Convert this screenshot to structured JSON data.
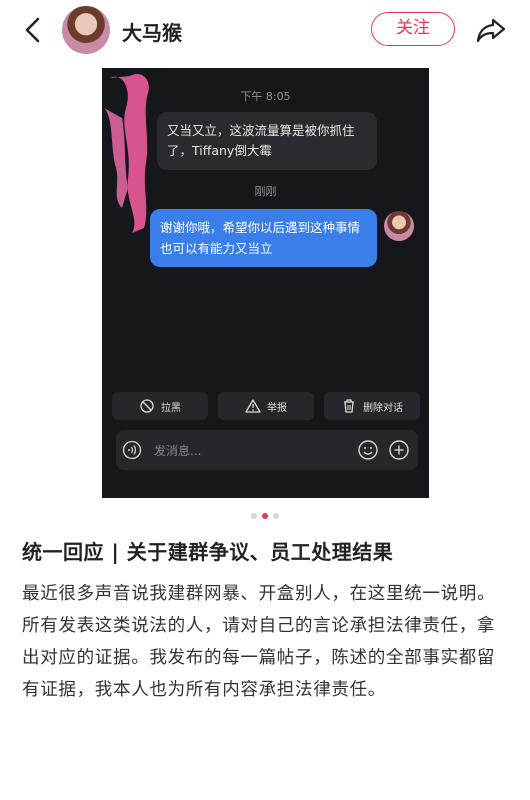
{
  "header": {
    "username": "大马猴",
    "follow_label": "关注"
  },
  "chat": {
    "time": "下午 8:05",
    "incoming_message": "又当又立，这波流量算是被你抓住了，Tiffany倒大霉",
    "recent_label": "刚刚",
    "outgoing_message": "谢谢你哦，希望你以后遇到这种事情也可以有能力又当立",
    "actions": [
      {
        "label": "拉黑",
        "icon": "block-icon"
      },
      {
        "label": "举报",
        "icon": "warning-icon"
      },
      {
        "label": "删除对话",
        "icon": "trash-icon"
      }
    ],
    "input_placeholder": "发消息...",
    "bubble_out_color": "#3a7eea",
    "bubble_in_color": "#2a2b30"
  },
  "carousel": {
    "total": 3,
    "active_index": 1
  },
  "post": {
    "title": "统一回应 | 关于建群争议、员工处理结果",
    "paragraphs": [
      "最近很多声音说我建群网暴、开盒别人，在这里统一说明。",
      "所有发表这类说法的人，请对自己的言论承担法律责任，拿出对应的证据。我发布的每一篇帖子，陈述的全部事实都留有证据，我本人也为所有内容承担法律责任。"
    ]
  },
  "colors": {
    "accent": "#f0354e"
  }
}
